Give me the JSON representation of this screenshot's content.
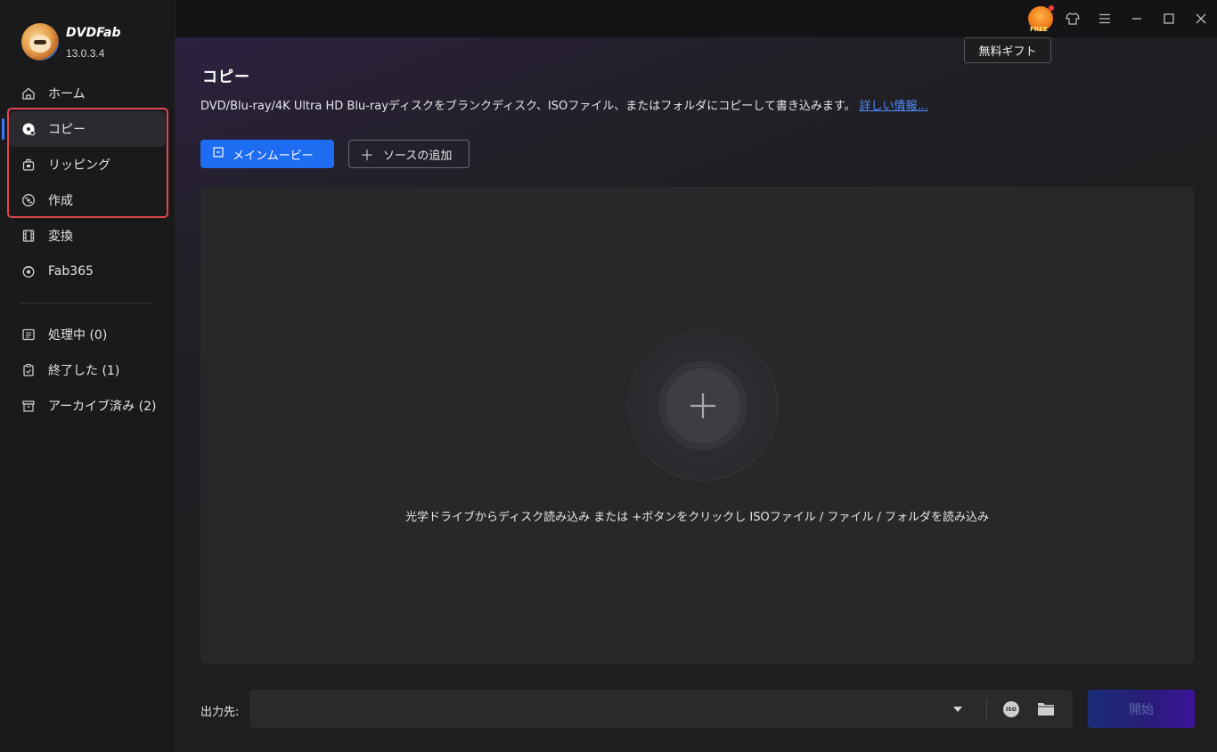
{
  "app": {
    "name": "DVDFab",
    "version": "13.0.3.4"
  },
  "sidebar": {
    "nav_items": [
      {
        "label": "ホーム",
        "icon": "home-icon"
      },
      {
        "label": "コピー",
        "icon": "disc-icon"
      },
      {
        "label": "リッピング",
        "icon": "rip-icon"
      },
      {
        "label": "作成",
        "icon": "create-icon"
      },
      {
        "label": "変換",
        "icon": "film-icon"
      },
      {
        "label": "Fab365",
        "icon": "fab365-icon"
      }
    ],
    "active_item": "コピー",
    "queue_items": [
      {
        "label": "処理中 (0)",
        "icon": "list-icon"
      },
      {
        "label": "終了した (1)",
        "icon": "clipboard-check-icon"
      },
      {
        "label": "アーカイブ済み (2)",
        "icon": "archive-icon"
      }
    ]
  },
  "titlebar": {
    "gift_tooltip": "無料ギフト"
  },
  "main": {
    "title": "コピー",
    "description": "DVD/Blu-ray/4K Ultra HD Blu-rayディスクをブランクディスク、ISOファイル、またはフォルダにコピーして書き込みます。",
    "more_link": "詳しい情報...",
    "mode_button": "メインムービー",
    "add_source_button": "ソースの追加",
    "drop_hint": "光学ドライブからディスク読み込み または +ボタンをクリックし ISOファイル / ファイル / フォルダを読み込み",
    "output_label": "出力先:",
    "output_value": "",
    "iso_label": "ISO",
    "start_button": "開始"
  },
  "colors": {
    "accent": "#1e6cf2",
    "highlight": "#e3474b",
    "link": "#4f8dff"
  }
}
